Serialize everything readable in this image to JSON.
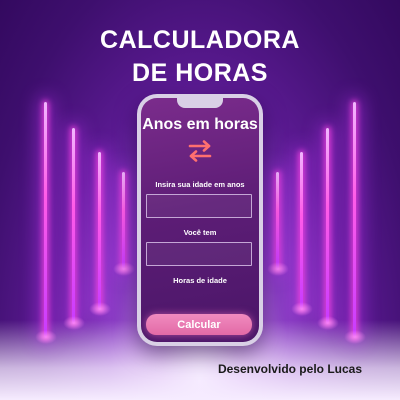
{
  "header": {
    "line1": "CALCULADORA",
    "line2": "DE HORAS"
  },
  "app": {
    "title": "Anos em horas",
    "swap_icon": "swap-arrows-icon",
    "age_label": "Insira sua idade em anos",
    "age_value": "",
    "result_label": "Você tem",
    "result_value": "",
    "unit_label": "Horas de idade",
    "button_label": "Calcular"
  },
  "footer": {
    "credit": "Desenvolvido pelo Lucas"
  },
  "colors": {
    "background": "#4a1579",
    "neon": "#ff5ce8",
    "button": "#e97ab3",
    "swap_icon": "#ff6f6f"
  }
}
